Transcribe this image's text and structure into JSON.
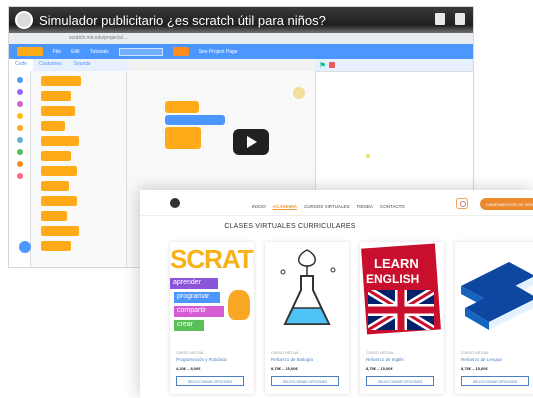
{
  "video": {
    "title": "Simulador publicitario ¿es scratch útil para niños?",
    "url_text": "scratch.mit.edu/projects/...",
    "menu": [
      "File",
      "Edit",
      "Tutorials",
      "Share",
      "See Project Page"
    ],
    "tabs": [
      "Code",
      "Costumes",
      "Sounds"
    ]
  },
  "site": {
    "nav": [
      "INICIO",
      "ACADEMIA",
      "CURSOS VIRTUALES",
      "TIENDA",
      "CONTACTO"
    ],
    "cta": "CAMPAMENTOS DE VERANO",
    "section_title": "CLASES VIRTUALES CURRICULARES",
    "button_label": "SELECCIONAR OPCIONES",
    "cards": [
      {
        "category": "CURSO VIRTUAL",
        "name": "Programación y Robótica",
        "price": "4,20€ – 8,00€",
        "image_words": [
          "SCRATC",
          "aprender",
          "programar",
          "compartir",
          "crear"
        ]
      },
      {
        "category": "CURSO VIRTUAL",
        "name": "Refuerzo de Biología",
        "price": "8,75€ – 15,00€"
      },
      {
        "category": "CURSO VIRTUAL",
        "name": "Refuerzo de Inglés",
        "price": "8,75€ – 15,00€",
        "image_words": [
          "LEARN",
          "ENGLISH"
        ]
      },
      {
        "category": "CURSO VIRTUAL",
        "name": "Refuerzo de Lengua",
        "price": "8,75€ – 15,00€"
      }
    ]
  },
  "colors": {
    "scratch_blue": "#4c97ff",
    "block_orange": "#ffab19",
    "site_orange": "#ec8a2e",
    "link_blue": "#4a7fc1"
  }
}
